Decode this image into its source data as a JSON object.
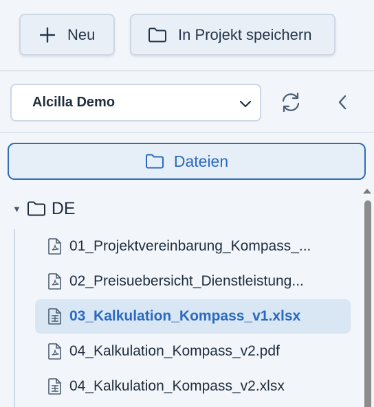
{
  "toolbar": {
    "new_label": "Neu",
    "save_label": "In Projekt speichern"
  },
  "project": {
    "selected": "Alcilla Demo"
  },
  "tabs": {
    "files_label": "Dateien"
  },
  "tree": {
    "folder": "DE",
    "files": [
      {
        "name": "01_Projektvereinbarung_Kompass_...",
        "icon": "pdf-file-icon"
      },
      {
        "name": "02_Preisuebersicht_Dienstleistung...",
        "icon": "pdf-file-icon"
      },
      {
        "name": "03_Kalkulation_Kompass_v1.xlsx",
        "icon": "spreadsheet-file-icon",
        "selected": true
      },
      {
        "name": "04_Kalkulation_Kompass_v2.pdf",
        "icon": "pdf-file-icon"
      },
      {
        "name": "04_Kalkulation_Kompass_v2.xlsx",
        "icon": "spreadsheet-file-icon"
      }
    ]
  },
  "colors": {
    "accent": "#2a6ac0",
    "background": "#f2f5f9",
    "selected_bg": "#d9e6f4"
  }
}
